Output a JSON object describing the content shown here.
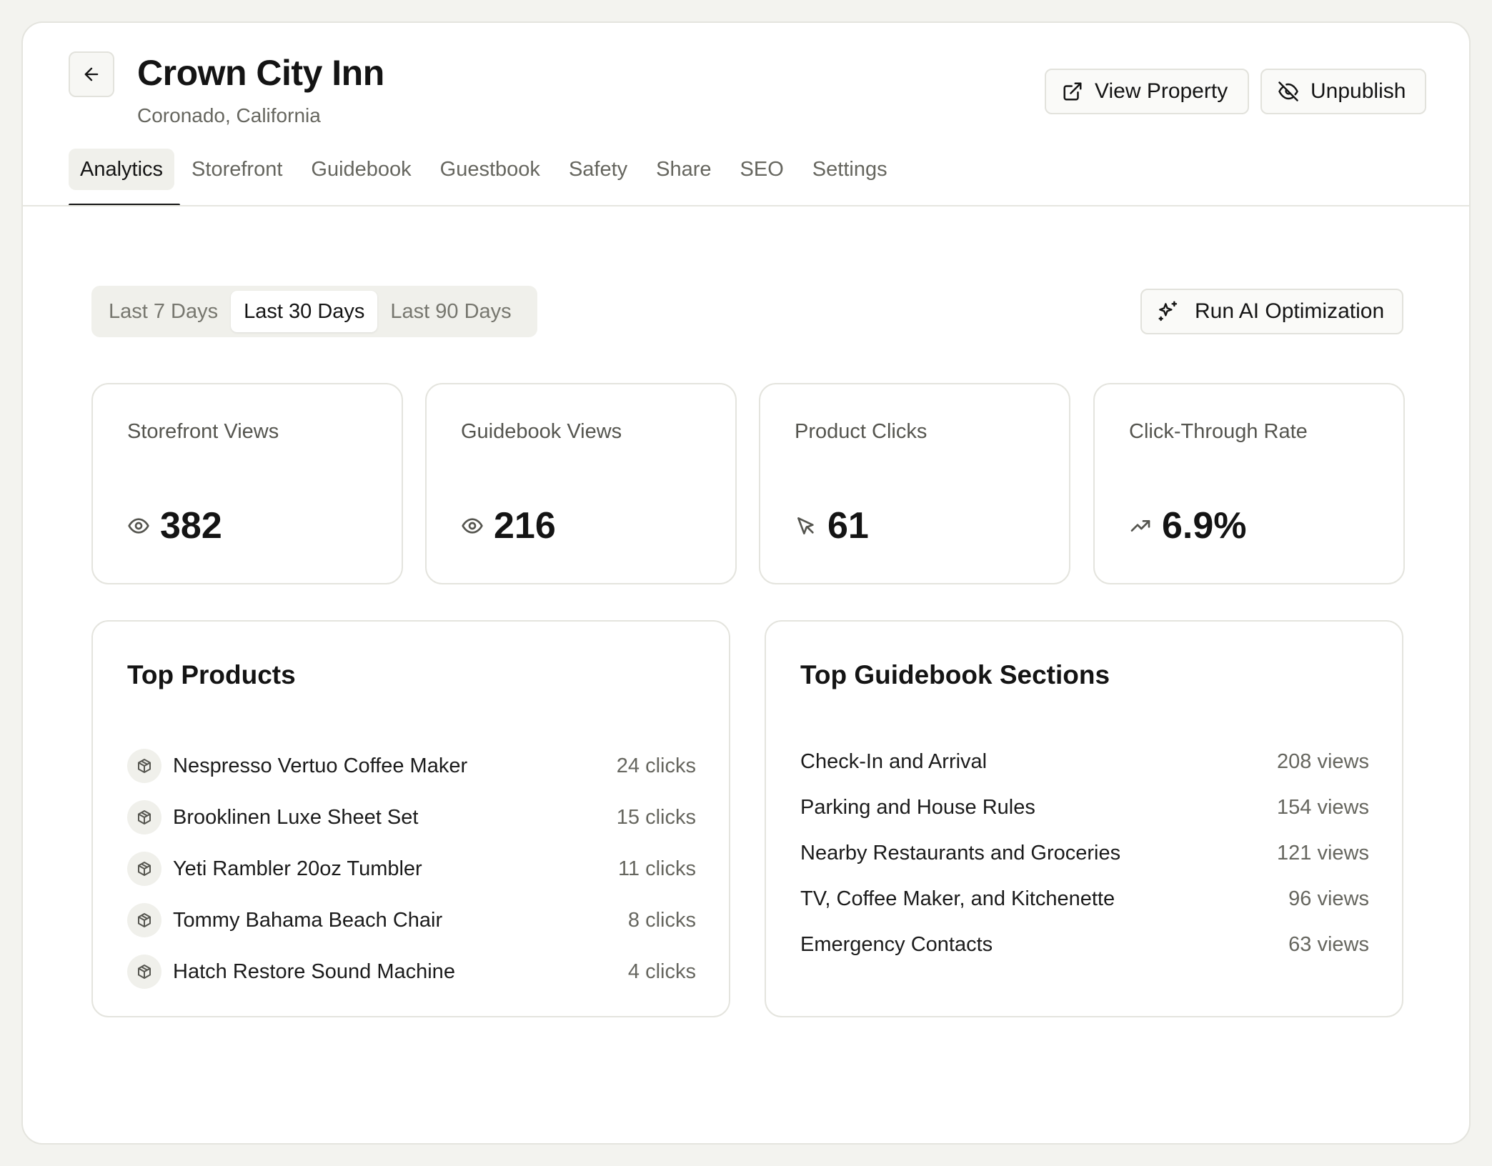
{
  "header": {
    "title": "Crown City Inn",
    "subtitle": "Coronado, California",
    "view_property_label": "View Property",
    "unpublish_label": "Unpublish"
  },
  "tabs": [
    {
      "label": "Analytics",
      "active": true
    },
    {
      "label": "Storefront"
    },
    {
      "label": "Guidebook"
    },
    {
      "label": "Guestbook"
    },
    {
      "label": "Safety"
    },
    {
      "label": "Share"
    },
    {
      "label": "SEO"
    },
    {
      "label": "Settings"
    }
  ],
  "range": {
    "options": [
      "Last 7 Days",
      "Last 30 Days",
      "Last 90 Days"
    ],
    "selected": "Last 30 Days"
  },
  "ai_button_label": "Run AI Optimization",
  "stats": [
    {
      "label": "Storefront Views",
      "value": "382",
      "icon": "eye-icon"
    },
    {
      "label": "Guidebook Views",
      "value": "216",
      "icon": "eye-icon"
    },
    {
      "label": "Product Clicks",
      "value": "61",
      "icon": "cursor-icon"
    },
    {
      "label": "Click-Through Rate",
      "value": "6.9%",
      "icon": "trending-up-icon"
    }
  ],
  "top_products": {
    "title": "Top Products",
    "items": [
      {
        "name": "Nespresso Vertuo Coffee Maker",
        "count": "24 clicks"
      },
      {
        "name": "Brooklinen Luxe Sheet Set",
        "count": "15 clicks"
      },
      {
        "name": "Yeti Rambler 20oz Tumbler",
        "count": "11 clicks"
      },
      {
        "name": "Tommy Bahama Beach Chair",
        "count": "8 clicks"
      },
      {
        "name": "Hatch Restore Sound Machine",
        "count": "4 clicks"
      }
    ]
  },
  "top_sections": {
    "title": "Top Guidebook Sections",
    "items": [
      {
        "name": "Check-In and Arrival",
        "count": "208 views"
      },
      {
        "name": "Parking and House Rules",
        "count": "154 views"
      },
      {
        "name": "Nearby Restaurants and Groceries",
        "count": "121 views"
      },
      {
        "name": "TV, Coffee Maker, and Kitchenette",
        "count": "96 views"
      },
      {
        "name": "Emergency Contacts",
        "count": "63 views"
      }
    ]
  }
}
